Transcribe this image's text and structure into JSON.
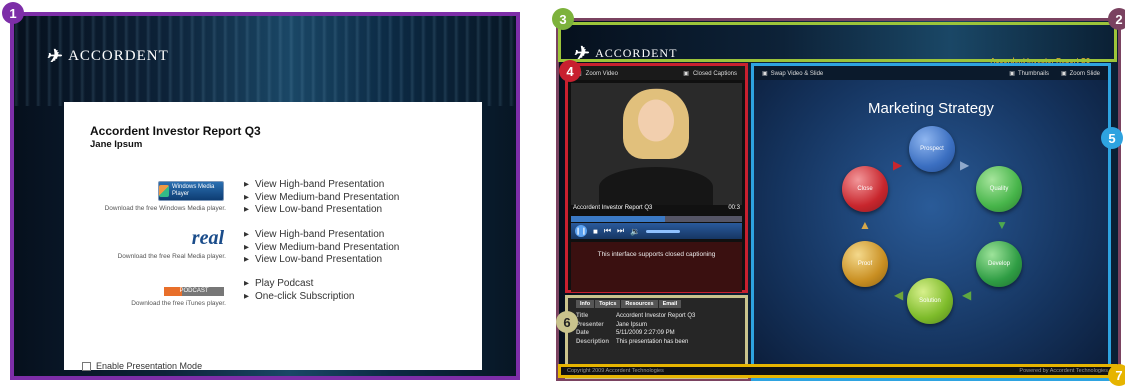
{
  "badges": [
    "1",
    "2",
    "3",
    "4",
    "5",
    "6",
    "7"
  ],
  "brand": "ACCORDENT",
  "left": {
    "report_title": "Accordent Investor Report Q3",
    "author": "Jane Ipsum",
    "players": [
      {
        "logo": "Windows Media Player",
        "download": "Download the free Windows Media player.",
        "links": [
          "View High-band Presentation",
          "View Medium-band Presentation",
          "View Low-band Presentation"
        ]
      },
      {
        "logo": "real",
        "download": "Download the free Real Media player.",
        "links": [
          "View High-band Presentation",
          "View Medium-band Presentation",
          "View Low-band Presentation"
        ]
      },
      {
        "logo": "PODCAST",
        "download": "Download the free iTunes player.",
        "links": [
          "Play Podcast",
          "One-click Subscription"
        ]
      }
    ],
    "presentation_mode": "Enable Presentation Mode"
  },
  "right": {
    "report_title": "Accordent Investor Report Q3",
    "video": {
      "toolbar_left": "Zoom Video",
      "toolbar_right": "Closed Captions",
      "caption_title": "Accordent Investor Report Q3",
      "caption_time": "00:3",
      "message": "This interface supports closed captioning"
    },
    "info": {
      "tabs": [
        "Info",
        "Topics",
        "Resources",
        "Email"
      ],
      "rows": [
        {
          "key": "Title",
          "value": "Accordent Investor Report Q3"
        },
        {
          "key": "Presenter",
          "value": "Jane Ipsum"
        },
        {
          "key": "Date",
          "value": "5/11/2009 2:27:09 PM"
        },
        {
          "key": "Description",
          "value": "This presentation has been"
        }
      ]
    },
    "slide": {
      "toolbar_left": "Swap Video & Slide",
      "toolbar_thumbs": "Thumbnails",
      "toolbar_zoom": "Zoom Slide",
      "title": "Marketing Strategy",
      "cycle": [
        "Prospect",
        "Quality",
        "Develop",
        "Solution",
        "Proof",
        "Close"
      ],
      "colors": {
        "prospect": "#3b6fc1",
        "quality": "#47b54a",
        "develop": "#2f9d44",
        "solution": "#7dbb2a",
        "proof": "#c98f22",
        "close": "#c8262d"
      }
    },
    "footer_left": "Copyright 2009 Accordent Technologies",
    "footer_right": "Powered by Accordent Technologies"
  },
  "colors": {
    "zone1": "#7d2ea8",
    "zone2": "#7a4260",
    "zone3": "#9cc43a",
    "zone4": "#c8202f",
    "zone5": "#2ea3e0",
    "zone6": "#c9c38d",
    "zone7": "#e6b400"
  }
}
